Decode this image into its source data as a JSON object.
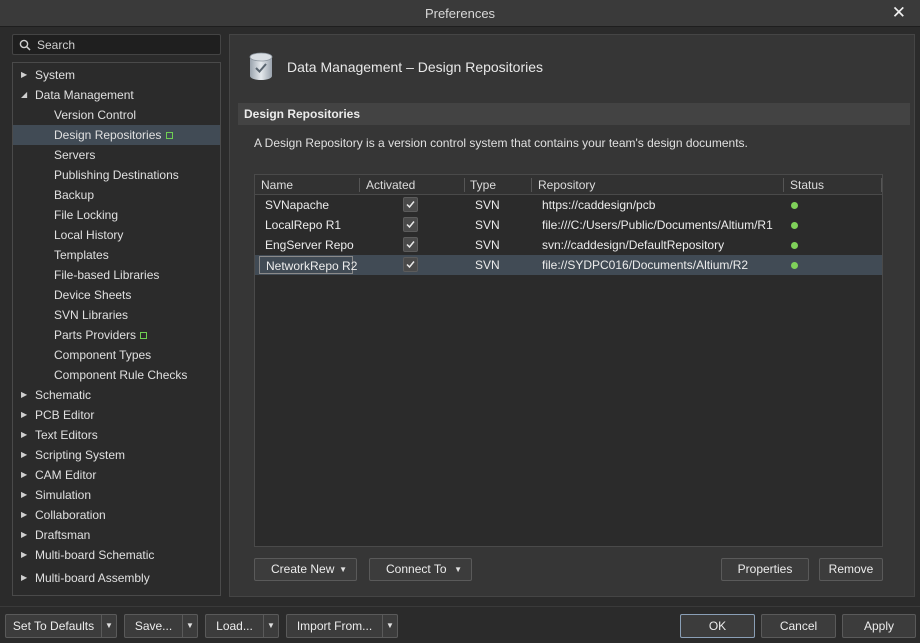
{
  "window": {
    "title": "Preferences"
  },
  "search": {
    "placeholder": "Search"
  },
  "tree": [
    {
      "label": "System",
      "level": 1,
      "arrow": "▶"
    },
    {
      "label": "Data Management",
      "level": 1,
      "arrow": "◢"
    },
    {
      "label": "Version Control",
      "level": 2
    },
    {
      "label": "Design Repositories",
      "level": 2,
      "badge": true,
      "selected": true
    },
    {
      "label": "Servers",
      "level": 2
    },
    {
      "label": "Publishing Destinations",
      "level": 2
    },
    {
      "label": "Backup",
      "level": 2
    },
    {
      "label": "File Locking",
      "level": 2
    },
    {
      "label": "Local History",
      "level": 2
    },
    {
      "label": "Templates",
      "level": 2
    },
    {
      "label": "File-based Libraries",
      "level": 2
    },
    {
      "label": "Device Sheets",
      "level": 2
    },
    {
      "label": "SVN Libraries",
      "level": 2
    },
    {
      "label": "Parts Providers",
      "level": 2,
      "badge": true
    },
    {
      "label": "Component Types",
      "level": 2
    },
    {
      "label": "Component Rule Checks",
      "level": 2
    },
    {
      "label": "Schematic",
      "level": 1,
      "arrow": "▶"
    },
    {
      "label": "PCB Editor",
      "level": 1,
      "arrow": "▶"
    },
    {
      "label": "Text Editors",
      "level": 1,
      "arrow": "▶"
    },
    {
      "label": "Scripting System",
      "level": 1,
      "arrow": "▶"
    },
    {
      "label": "CAM Editor",
      "level": 1,
      "arrow": "▶"
    },
    {
      "label": "Simulation",
      "level": 1,
      "arrow": "▶"
    },
    {
      "label": "Collaboration",
      "level": 1,
      "arrow": "▶"
    },
    {
      "label": "Draftsman",
      "level": 1,
      "arrow": "▶"
    },
    {
      "label": "Multi-board Schematic",
      "level": 1,
      "arrow": "▶"
    },
    {
      "label": "Multi-board Assembly",
      "level": 1,
      "arrow": "▶"
    }
  ],
  "page": {
    "title": "Data Management – Design Repositories",
    "section": "Design Repositories",
    "description": "A Design Repository is a version control system that contains your team's design documents."
  },
  "grid": {
    "columns": [
      "Name",
      "Activated",
      "Type",
      "Repository",
      "Status"
    ],
    "rows": [
      {
        "name": "SVNapache",
        "activated": true,
        "type": "SVN",
        "repository": "https://caddesign/pcb",
        "status": "ok"
      },
      {
        "name": "LocalRepo R1",
        "activated": true,
        "type": "SVN",
        "repository": "file:///C:/Users/Public/Documents/Altium/R1",
        "status": "ok"
      },
      {
        "name": "EngServer Repo",
        "activated": true,
        "type": "SVN",
        "repository": "svn://caddesign/DefaultRepository",
        "status": "ok"
      },
      {
        "name": "NetworkRepo R2",
        "activated": true,
        "type": "SVN",
        "repository": "file://SYDPC016/Documents/Altium/R2",
        "status": "ok",
        "selected": true
      }
    ]
  },
  "panel_buttons": {
    "create_new": "Create New",
    "connect_to": "Connect To",
    "properties": "Properties",
    "remove": "Remove"
  },
  "footer": {
    "set_to_defaults": "Set To Defaults",
    "save": "Save...",
    "load": "Load...",
    "import_from": "Import From...",
    "ok": "OK",
    "cancel": "Cancel",
    "apply": "Apply"
  },
  "colors": {
    "selection": "#414b55",
    "status_ok": "#7fd15a",
    "badge": "#6ecf52"
  }
}
